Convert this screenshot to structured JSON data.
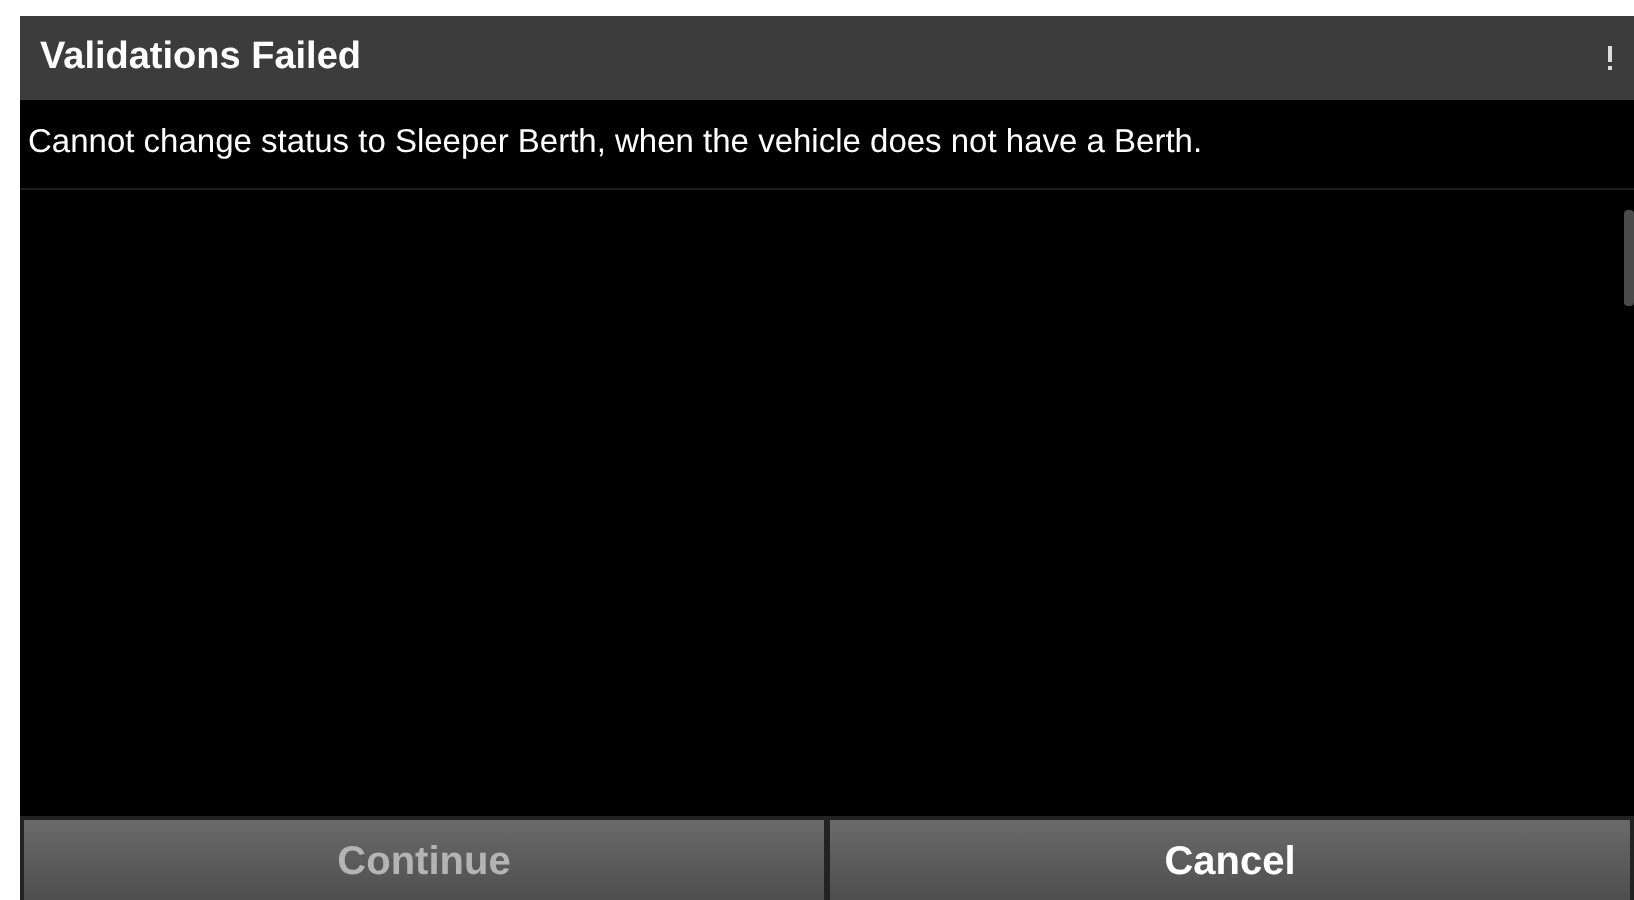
{
  "dialog": {
    "title": "Validations Failed",
    "message": "Cannot change status to Sleeper Berth, when the vehicle does not have a Berth."
  },
  "buttons": [
    {
      "label": "Continue",
      "disabled": true
    },
    {
      "label": "Cancel",
      "disabled": false
    }
  ]
}
